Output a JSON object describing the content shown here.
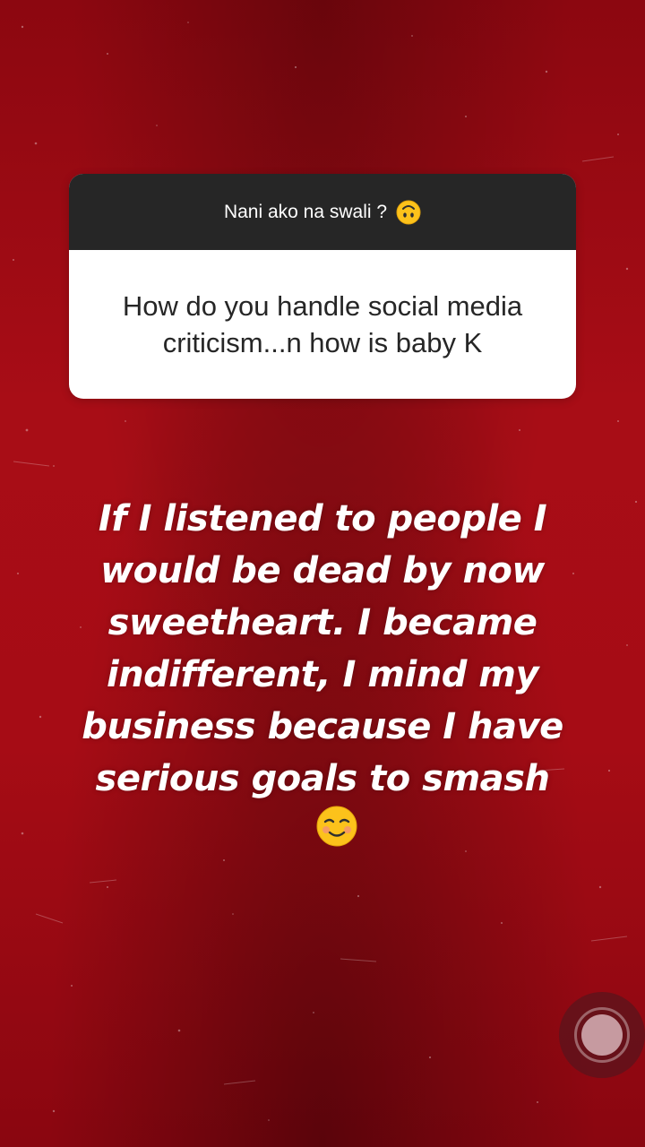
{
  "question_sticker": {
    "prompt": "Nani ako na swali ?",
    "prompt_emoji": "upside-down-face-icon",
    "question": "How do you handle social media criticism...n how is baby K"
  },
  "answer": {
    "text": "If I listened to people I would be dead by now sweetheart. I became indifferent, I mind my business because I have serious goals to smash",
    "emoji": "smiling-face-icon"
  },
  "colors": {
    "background": "#a60c15",
    "card_header": "#262626",
    "card_body": "#ffffff",
    "answer_text": "#ffffff"
  }
}
